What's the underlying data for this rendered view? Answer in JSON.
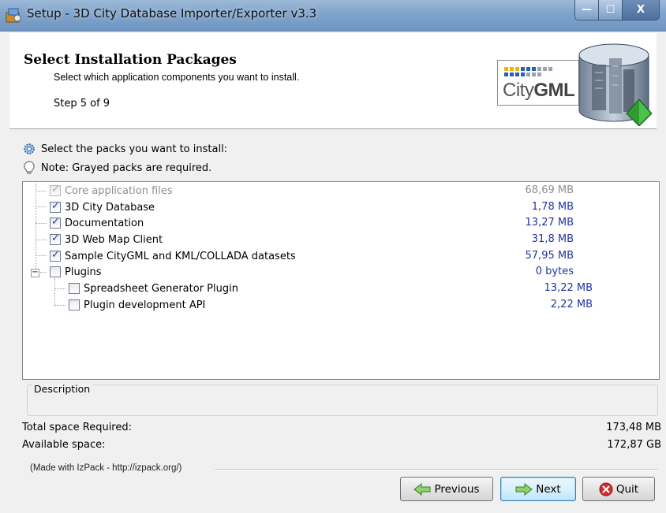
{
  "window": {
    "title": "Setup - 3D City Database Importer/Exporter v3.3",
    "controls": {
      "minimize": "—",
      "maximize": "☐",
      "close": "X"
    }
  },
  "header": {
    "title": "Select Installation Packages",
    "subtitle": "Select which application components you want to install.",
    "step": "Step 5 of 9",
    "logo_text_light": "City",
    "logo_text_bold": "GML"
  },
  "notes": {
    "select_packs": "Select the packs you want to install:",
    "grayed_note": "Note: Grayed packs are required."
  },
  "packs": [
    {
      "label": "Core application files",
      "size": "68,69 MB",
      "checked": true,
      "required": true
    },
    {
      "label": "3D City Database",
      "size": "1,78 MB",
      "checked": true,
      "required": false
    },
    {
      "label": "Documentation",
      "size": "13,27 MB",
      "checked": true,
      "required": false
    },
    {
      "label": "3D Web Map Client",
      "size": "31,8 MB",
      "checked": true,
      "required": false
    },
    {
      "label": "Sample CityGML and KML/COLLADA datasets",
      "size": "57,95 MB",
      "checked": true,
      "required": false
    },
    {
      "label": "Plugins",
      "size": "0 bytes",
      "checked": false,
      "required": false,
      "expanded": true
    },
    {
      "label": "Spreadsheet Generator Plugin",
      "size": "13,22 MB",
      "checked": false,
      "required": false
    },
    {
      "label": "Plugin development API",
      "size": "2,22 MB",
      "checked": false,
      "required": false
    }
  ],
  "description": {
    "label": "Description",
    "text": ""
  },
  "space": {
    "required_label": "Total space Required:",
    "required_value": "173,48 MB",
    "available_label": "Available space:",
    "available_value": "172,87 GB"
  },
  "footer": {
    "made_with": "(Made with IzPack - http://izpack.org/)",
    "previous": "Previous",
    "next": "Next",
    "quit": "Quit"
  },
  "colors": {
    "size_text": "#1f35a0",
    "required_gray": "#8f8f8f",
    "titlebar": "#7fa3cb"
  }
}
